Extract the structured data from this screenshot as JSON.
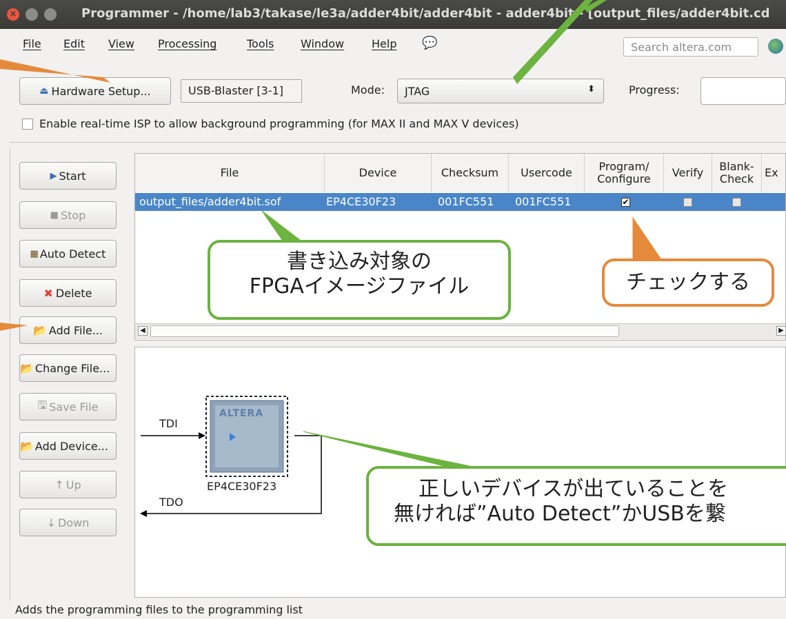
{
  "window": {
    "title": "Programmer - /home/lab3/takase/le3a/adder4bit/adder4bit - adder4bit - [output_files/adder4bit.cd"
  },
  "menu": [
    "File",
    "Edit",
    "View",
    "Processing",
    "Tools",
    "Window",
    "Help"
  ],
  "search": {
    "placeholder": "Search altera.com"
  },
  "toolbar": {
    "hardware_setup": "Hardware Setup...",
    "hardware_value": "USB-Blaster [3-1]",
    "mode_label": "Mode:",
    "mode_value": "JTAG",
    "progress_label": "Progress:"
  },
  "isp_label": "Enable real-time ISP to allow background programming (for MAX II and MAX V devices)",
  "side_buttons": {
    "start": "Start",
    "stop": "Stop",
    "auto_detect": "Auto Detect",
    "delete": "Delete",
    "add_file": "Add File...",
    "change_file": "Change File...",
    "save_file": "Save File",
    "add_device": "Add Device...",
    "up": "Up",
    "down": "Down"
  },
  "table": {
    "headers": {
      "file": "File",
      "device": "Device",
      "checksum": "Checksum",
      "usercode": "Usercode",
      "program_configure": "Program/ Configure",
      "verify": "Verify",
      "blank_check": "Blank- Check",
      "examine": "Ex"
    },
    "row": {
      "file": "output_files/adder4bit.sof",
      "device": "EP4CE30F23",
      "checksum": "001FC551",
      "usercode": "001FC551",
      "program_configure": true,
      "verify": false,
      "blank_check": false
    }
  },
  "chain": {
    "tdi": "TDI",
    "tdo": "TDO",
    "device": "EP4CE30F23",
    "chip_logo": "ALTERA"
  },
  "callouts": {
    "image_file": "書き込み対象の\nFPGAイメージファイル",
    "check": "チェックする",
    "device_note_1": "正しいデバイスが出ていることを",
    "device_note_2": "無ければ”Auto Detect”かUSBを繋"
  },
  "colors": {
    "annotation_orange": "#e58a3a",
    "annotation_green": "#6cb33f",
    "selection_blue": "#4a86c7"
  },
  "status": "Adds the programming files to the programming list"
}
